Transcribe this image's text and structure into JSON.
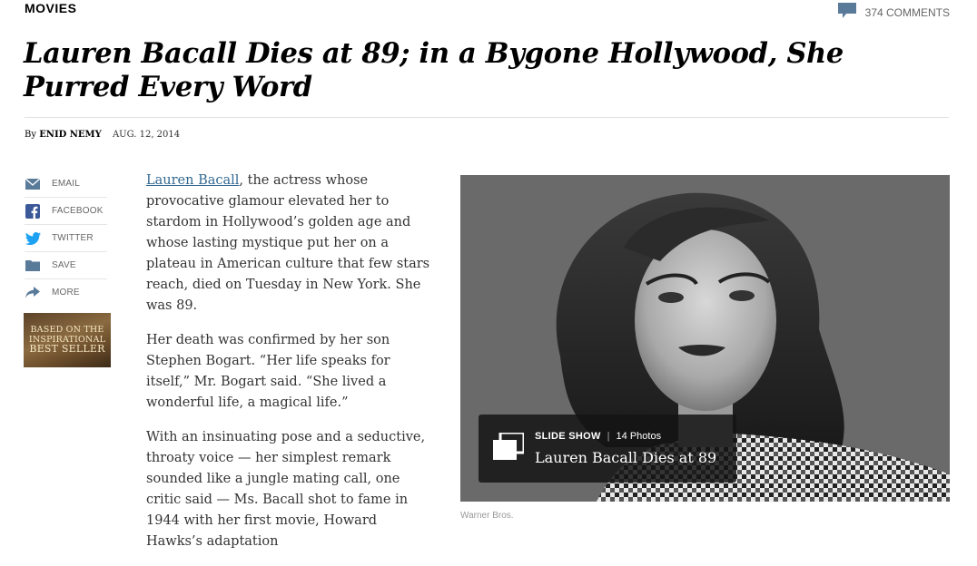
{
  "section": "MOVIES",
  "comments": {
    "label": "374 COMMENTS"
  },
  "headline": "Lauren Bacall Dies at 89; in a Bygone Hollywood, She Purred Every Word",
  "byline": {
    "prefix": "By",
    "author": "ENID NEMY",
    "date": "AUG. 12, 2014"
  },
  "share": [
    {
      "label": "EMAIL",
      "icon": "mail-icon"
    },
    {
      "label": "FACEBOOK",
      "icon": "facebook-icon"
    },
    {
      "label": "TWITTER",
      "icon": "twitter-icon"
    },
    {
      "label": "SAVE",
      "icon": "folder-icon"
    },
    {
      "label": "MORE",
      "icon": "share-arrow-icon"
    }
  ],
  "ad": {
    "line1": "BASED ON THE",
    "line2": "INSPIRATIONAL",
    "line3": "BEST SELLER"
  },
  "article": {
    "p1_link": "Lauren Bacall",
    "p1_text": ", the actress whose provocative glamour elevated her to stardom in Hollywood’s golden age and whose lasting mystique put her on a plateau in American culture that few stars reach, died on Tuesday in New York. She was 89.",
    "p2": "Her death was confirmed by her son Stephen Bogart. “Her life speaks for itself,” Mr. Bogart said. “She lived a wonderful life, a magical life.”",
    "p3": "With an insinuating pose and a seductive, throaty voice — her simplest remark sounded like a jungle mating call, one critic said — Ms. Bacall shot to fame in 1944 with her first movie, Howard Hawks’s adaptation"
  },
  "photo": {
    "credit": "Warner Bros.",
    "slideshow": {
      "kicker": "SLIDE SHOW",
      "count": "14 Photos",
      "title": "Lauren Bacall Dies at 89"
    }
  },
  "colors": {
    "link": "#326891",
    "accent_icon": "#5a7a9a",
    "facebook": "#3b5998",
    "twitter": "#1da1f2"
  }
}
